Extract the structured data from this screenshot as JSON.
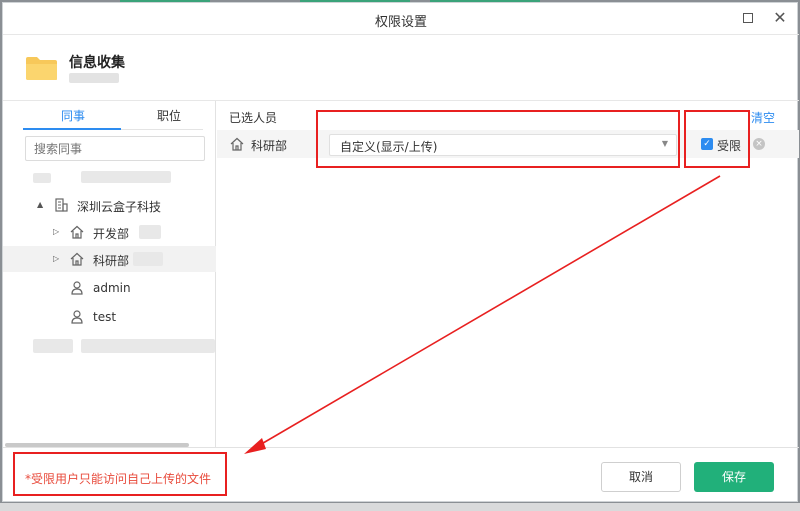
{
  "window": {
    "title": "权限设置",
    "maximize_icon": "maximize-icon",
    "close_icon": "close-icon",
    "close_glyph": "✕"
  },
  "header": {
    "folder_icon": "folder-icon",
    "folder_name": "信息收集"
  },
  "left_panel": {
    "tabs": [
      {
        "label": "同事",
        "active": true
      },
      {
        "label": "职位",
        "active": false
      }
    ],
    "search_placeholder": "搜索同事",
    "tree": [
      {
        "label": "深圳云盒子科技",
        "icon": "building-icon",
        "caret": "▲"
      },
      {
        "label": "开发部",
        "icon": "home-icon",
        "caret": "▷"
      },
      {
        "label": "科研部",
        "icon": "home-icon",
        "caret": "▷"
      },
      {
        "label": "admin",
        "icon": "user-icon"
      },
      {
        "label": "test",
        "icon": "user-icon"
      }
    ]
  },
  "right_panel": {
    "selected_label": "已选人员",
    "clear_label": "清空",
    "members": [
      {
        "name": "科研部",
        "icon": "home-icon",
        "permission": "自定义(显示/上传)",
        "restricted_label": "受限",
        "restricted": true
      }
    ]
  },
  "footer": {
    "note": "*受限用户只能访问自己上传的文件",
    "cancel_label": "取消",
    "save_label": "保存"
  },
  "colors": {
    "accent": "#2d8cf0",
    "save": "#21b07a",
    "annotation": "#e82020",
    "note": "#e84b3c"
  }
}
